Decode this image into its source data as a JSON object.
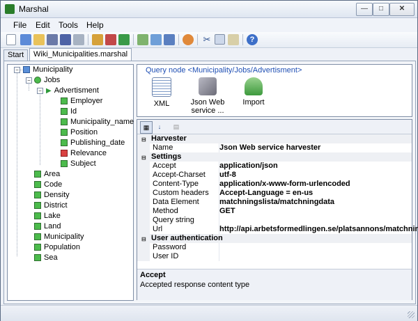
{
  "window": {
    "title": "Marshal"
  },
  "menu": [
    "File",
    "Edit",
    "Tools",
    "Help"
  ],
  "tabs": [
    "Start",
    "Wiki_Municipalities.marshal"
  ],
  "tree": {
    "root": "Municipality",
    "jobs": "Jobs",
    "advertisment": "Advertisment",
    "ad_fields": [
      "Employer",
      "Id",
      "Municipality_name",
      "Position",
      "Publishing_date",
      "Relevance",
      "Subject"
    ],
    "root_fields": [
      "Area",
      "Code",
      "Density",
      "District",
      "Lake",
      "Land",
      "Municipality",
      "Population",
      "Sea"
    ]
  },
  "query_node": {
    "title": "Query node <Municipality/Jobs/Advertisment>",
    "items": [
      {
        "label1": "XML",
        "label2": ""
      },
      {
        "label1": "Json Web",
        "label2": "service ..."
      },
      {
        "label1": "Import",
        "label2": ""
      }
    ]
  },
  "properties": {
    "harvester_cat": "Harvester",
    "name_label": "Name",
    "name_value": "Json Web service harvester",
    "settings_cat": "Settings",
    "settings": [
      {
        "label": "Accept",
        "value": "application/json"
      },
      {
        "label": "Accept-Charset",
        "value": "utf-8"
      },
      {
        "label": "Content-Type",
        "value": "application/x-www-form-urlencoded"
      },
      {
        "label": "Custom headers",
        "value": "Accept-Language = en-us"
      },
      {
        "label": "Data Element",
        "value": "matchningslista/matchningdata"
      },
      {
        "label": "Method",
        "value": "GET"
      },
      {
        "label": "Query string",
        "value": ""
      },
      {
        "label": "Url",
        "value": "http://api.arbetsformedlingen.se/platsannons/matchning"
      }
    ],
    "auth_cat": "User authentication",
    "auth": [
      {
        "label": "Password",
        "value": ""
      },
      {
        "label": "User ID",
        "value": ""
      }
    ]
  },
  "description": {
    "title": "Accept",
    "text": "Accepted response content type"
  },
  "icons": [
    "app-icon",
    "minimize-icon",
    "maximize-icon",
    "close-icon"
  ]
}
